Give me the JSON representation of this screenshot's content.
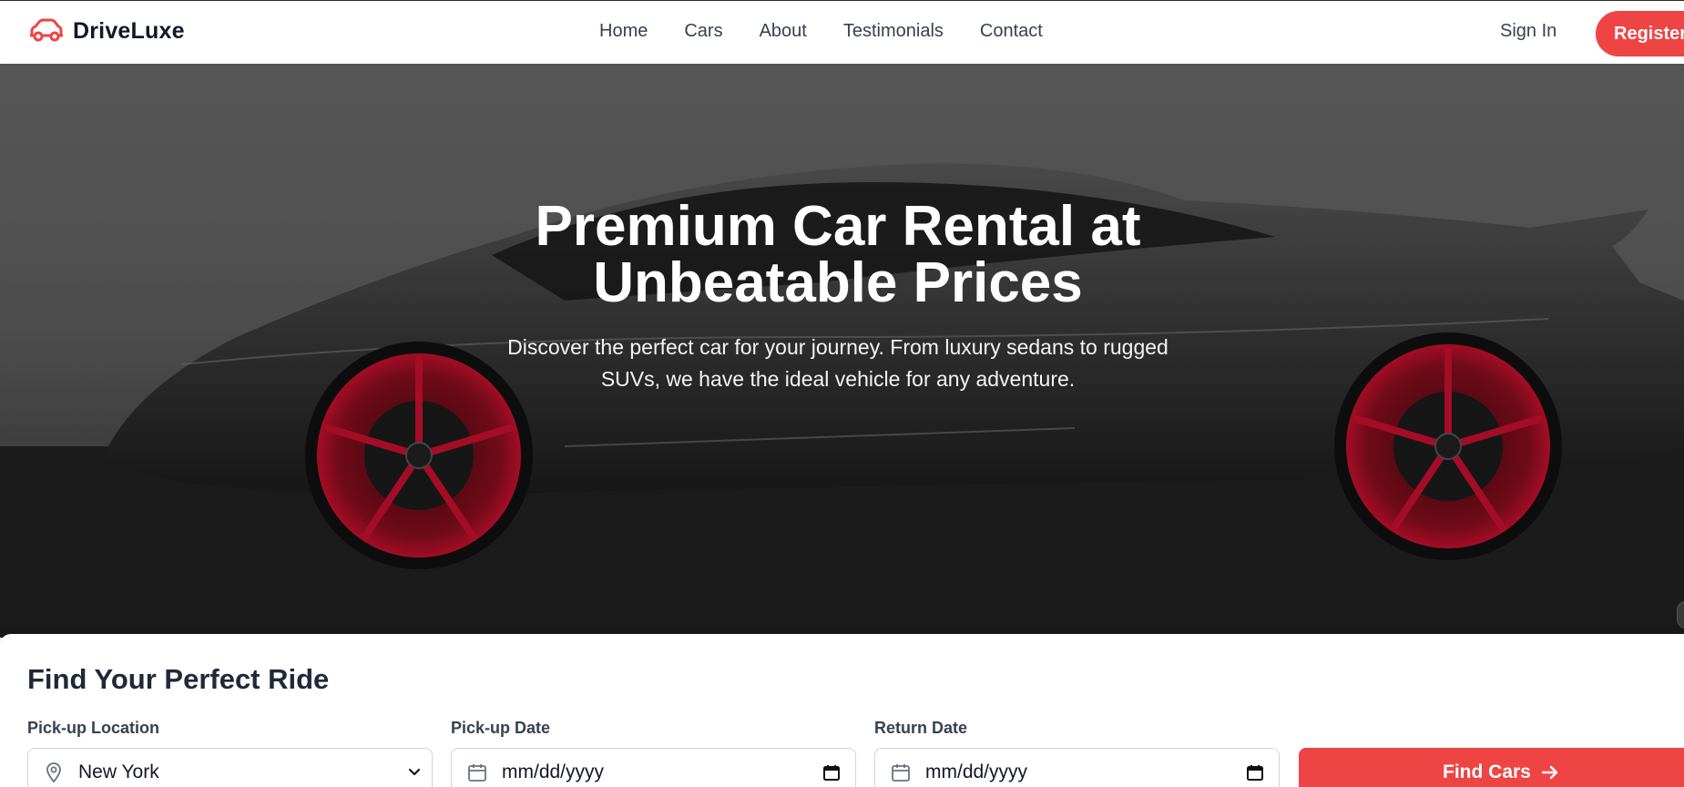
{
  "colors": {
    "accent": "#ef4444",
    "text_dark": "#1f2937",
    "hero_bg": "#5f5f5f",
    "wheel": "#c8102e"
  },
  "brand": {
    "name": "DriveLuxe",
    "icon": "car-icon"
  },
  "nav": {
    "links": [
      {
        "label": "Home"
      },
      {
        "label": "Cars"
      },
      {
        "label": "About"
      },
      {
        "label": "Testimonials"
      },
      {
        "label": "Contact"
      }
    ],
    "sign_in": "Sign In",
    "register": "Register"
  },
  "hero": {
    "title_line1": "Premium Car Rental at",
    "title_line2": "Unbeatable Prices",
    "subtitle_line1": "Discover the perfect car for your journey. From luxury sedans to rugged",
    "subtitle_line2": "SUVs, we have the ideal vehicle for any adventure."
  },
  "search": {
    "title": "Find Your Perfect Ride",
    "location": {
      "label": "Pick-up Location",
      "value": "New York",
      "icon": "map-pin-icon"
    },
    "pickup_date": {
      "label": "Pick-up Date",
      "placeholder": "mm/dd/yyyy",
      "icon": "calendar-icon"
    },
    "return_date": {
      "label": "Return Date",
      "placeholder": "mm/dd/yyyy",
      "icon": "calendar-icon"
    },
    "button": {
      "label": "Find Cars",
      "icon": "arrow-right-icon"
    }
  }
}
